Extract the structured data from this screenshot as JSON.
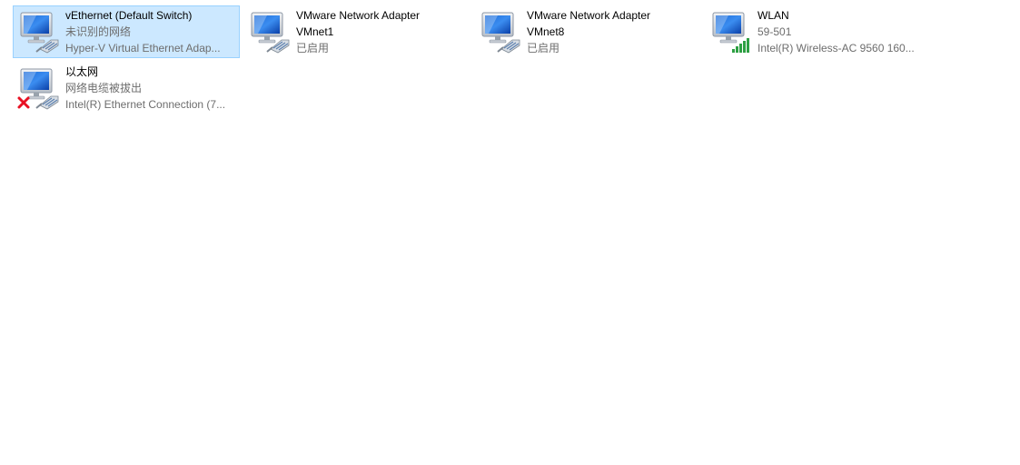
{
  "adapters": [
    {
      "name": "vEthernet (Default Switch)",
      "status": "未识别的网络",
      "device": "Hyper-V Virtual Ethernet Adap...",
      "selected": true,
      "icon": "ethernet-adapter-icon"
    },
    {
      "name": "VMware Network Adapter",
      "status": "VMnet1",
      "device": "已启用",
      "selected": false,
      "icon": "ethernet-adapter-icon"
    },
    {
      "name": "VMware Network Adapter",
      "status": "VMnet8",
      "device": "已启用",
      "selected": false,
      "icon": "ethernet-adapter-icon"
    },
    {
      "name": "WLAN",
      "status": "59-501",
      "device": "Intel(R) Wireless-AC 9560 160...",
      "selected": false,
      "icon": "wifi-adapter-icon"
    },
    {
      "name": "以太网",
      "status": "网络电缆被拔出",
      "device": "Intel(R) Ethernet Connection (7...",
      "selected": false,
      "icon": "ethernet-disconnected-icon"
    }
  ],
  "colors": {
    "selection_bg": "#cce8ff",
    "selection_border": "#99d1ff",
    "secondary_text": "#6d6d6d",
    "error_red": "#e81123",
    "signal_green": "#2ea043"
  }
}
